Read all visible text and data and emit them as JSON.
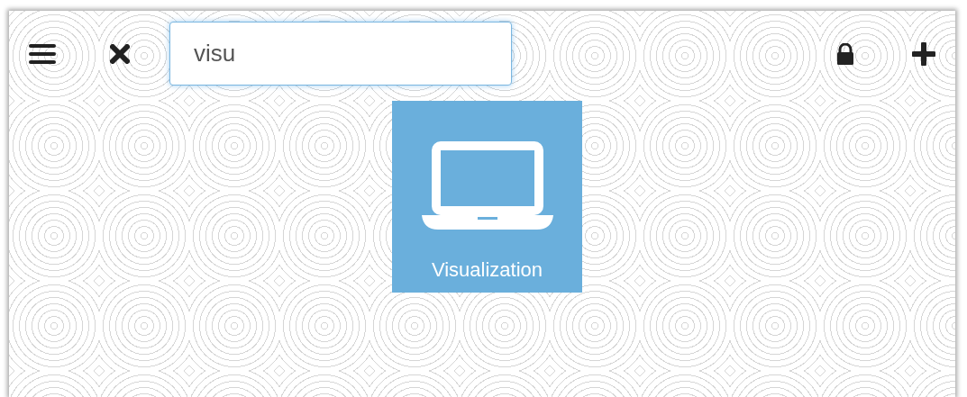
{
  "search": {
    "value": "visu"
  },
  "tiles": [
    {
      "label": "Visualization"
    }
  ]
}
